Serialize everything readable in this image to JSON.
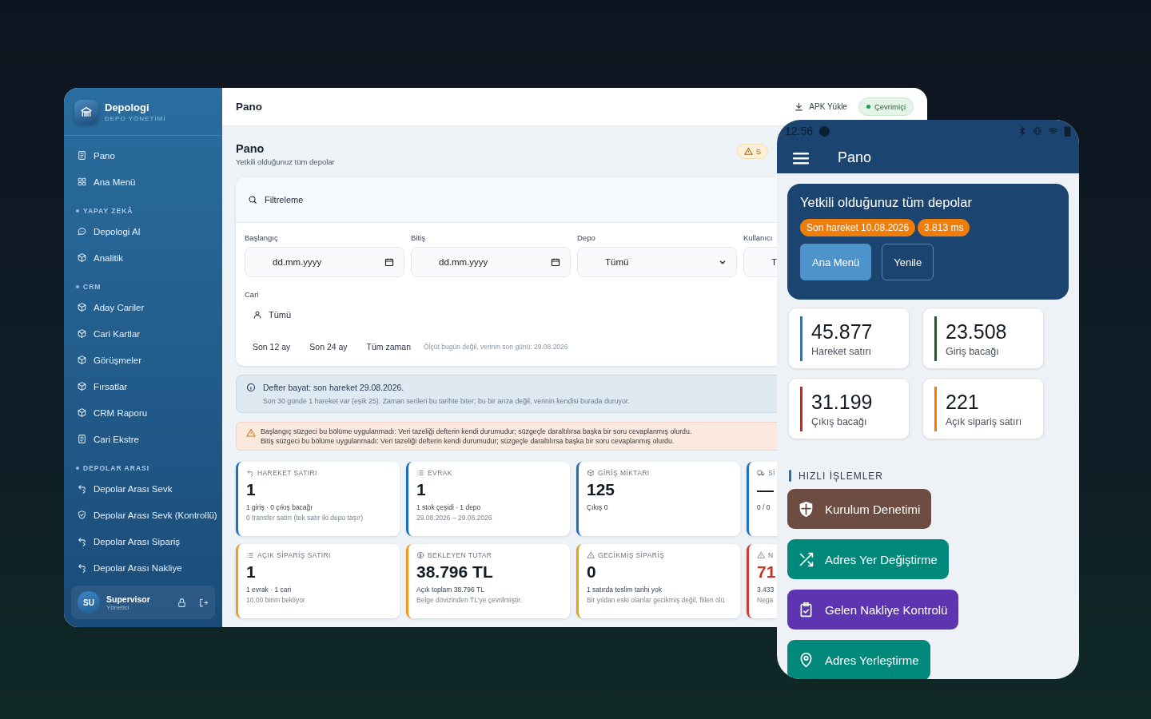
{
  "sidebar": {
    "brand": "Depologi",
    "brand_subtitle": "DEPO YÖNETİMİ",
    "groups": [
      {
        "items": [
          "Pano",
          "Ana Menü"
        ]
      },
      {
        "heading": "YAPAY ZEKÂ",
        "items": [
          "Depologi AI",
          "Analitik"
        ]
      },
      {
        "heading": "CRM",
        "items": [
          "Aday Cariler",
          "Cari Kartlar",
          "Görüşmeler",
          "Fırsatlar",
          "CRM Raporu",
          "Cari Ekstre"
        ]
      },
      {
        "heading": "DEPOLAR ARASI",
        "items": [
          "Depolar Arası Sevk",
          "Depolar Arası Sevk (Kontrollü)",
          "Depolar Arası Sipariş",
          "Depolar Arası Nakliye"
        ]
      }
    ],
    "user": {
      "initials": "SU",
      "name": "Supervisor",
      "role": "Yönetici"
    }
  },
  "header": {
    "title": "Pano",
    "apk_button": "APK Yükle",
    "status": "Çevrimiçi"
  },
  "page": {
    "title": "Pano",
    "subtitle": "Yetkili olduğunuz tüm depolar",
    "badge": "S"
  },
  "filter": {
    "title": "Filtreleme",
    "fields": [
      {
        "kind": "date",
        "label": "Başlangıç",
        "placeholder": "dd.mm.yyyy"
      },
      {
        "kind": "date",
        "label": "Bitiş",
        "placeholder": "dd.mm.yyyy"
      },
      {
        "kind": "select",
        "label": "Depo",
        "value": "Tümü"
      },
      {
        "kind": "clipped",
        "label": "Kullanıcı",
        "value": "T"
      }
    ],
    "cari": {
      "label": "Cari",
      "value": "Tümü"
    },
    "ranges": [
      "Son 12 ay",
      "Son 24 ay",
      "Tüm zaman"
    ],
    "note": "Ölçüt bugün değil, verinin son günü: 29.08.2026"
  },
  "info_alert": {
    "title": "Defter bayat: son hareket 29.08.2026.",
    "text": "Son 30 günde 1 hareket var (eşik 25). Zaman serileri bu tarihte biter; bu bir arıza değil, verinin kendisi burada duruyor."
  },
  "warning_alert": {
    "lines": [
      "Başlangıç süzgeci bu bölüme uygulanmadı: Veri tazeliği defterin kendi durumudur; süzgeçle daraltılırsa başka bir soru cevaplanmış olurdu.",
      "Bitiş süzgeci bu bölüme uygulanmadı: Veri tazeliği defterin kendi durumudur; süzgeçle daraltılırsa başka bir soru cevaplanmış olurdu."
    ]
  },
  "kpi_cards": [
    {
      "title": "HAREKET SATIRI",
      "value": "1",
      "lines": [
        "1 giriş · 0 çıkış bacağı",
        "0 transfer satırı (tek satır iki depo taşır)"
      ],
      "color": "#1f6fc1",
      "alert": false
    },
    {
      "title": "EVRAK",
      "value": "1",
      "lines": [
        "1 stok çeşidi · 1 depo",
        "29.08.2026 – 29.08.2026"
      ],
      "color": "#1f6fc1",
      "alert": false
    },
    {
      "title": "GİRİŞ MİKTARI",
      "value": "125",
      "lines": [
        "Çıkış 0"
      ],
      "color": "#1f6fc1",
      "alert": false
    },
    {
      "title": "Sİ",
      "value": "—",
      "lines": [
        "0 / 0"
      ],
      "color": "#1f6fc1",
      "alert": false
    },
    {
      "title": "AÇIK SİPARİŞ SATIRI",
      "value": "1",
      "lines": [
        "1 evrak · 1 cari",
        "10,00 birim bekliyor"
      ],
      "color": "#ef9a1a",
      "alert": false
    },
    {
      "title": "BEKLEYEN TUTAR",
      "value": "38.796 TL",
      "lines": [
        "Açık toplam 38.796 TL",
        "Belge dövizinden TL'ye çevrilmiştir."
      ],
      "color": "#ef9a1a",
      "alert": false
    },
    {
      "title": "GECİKMİŞ SİPARİŞ",
      "value": "0",
      "lines": [
        "1 satırda teslim tarihi yok",
        "Bir yıldan eski olanlar gecikmiş değil, fiilen ölü"
      ],
      "color": "#ef9a1a",
      "alert": false
    },
    {
      "title": "N",
      "value": "71",
      "lines": [
        "3.433",
        "Nega"
      ],
      "color": "#d33a32",
      "alert": true
    }
  ],
  "phone": {
    "status_time": "12:56",
    "title": "Pano",
    "hero": {
      "title": "Yetkili olduğunuz tüm depolar",
      "chips": [
        "Son hareket 10.08.2026",
        "3.813 ms"
      ],
      "buttons": [
        {
          "label": "Ana Menü",
          "kind": "filled"
        },
        {
          "label": "Yenile",
          "kind": "outlined"
        }
      ]
    },
    "stats": [
      {
        "value": "45.877",
        "label": "Hareket satırı",
        "color": "#1976d2"
      },
      {
        "value": "23.508",
        "label": "Giriş bacağı",
        "color": "#1b5e20"
      },
      {
        "value": "31.199",
        "label": "Çıkış bacağı",
        "color": "#c62828"
      },
      {
        "value": "221",
        "label": "Açık sipariş satırı",
        "color": "#f57c00"
      }
    ],
    "quick_heading": "HIZLI İŞLEMLER",
    "actions": [
      {
        "label": "Kurulum Denetimi",
        "color": "#6d4c41"
      },
      {
        "label": "Adres Yer Değiştirme",
        "color": "#00897b"
      },
      {
        "label": "Gelen Nakliye Kontrolü",
        "color": "#5e35b1"
      },
      {
        "label": "Adres Yerleştirme",
        "color": "#00897b"
      }
    ]
  }
}
